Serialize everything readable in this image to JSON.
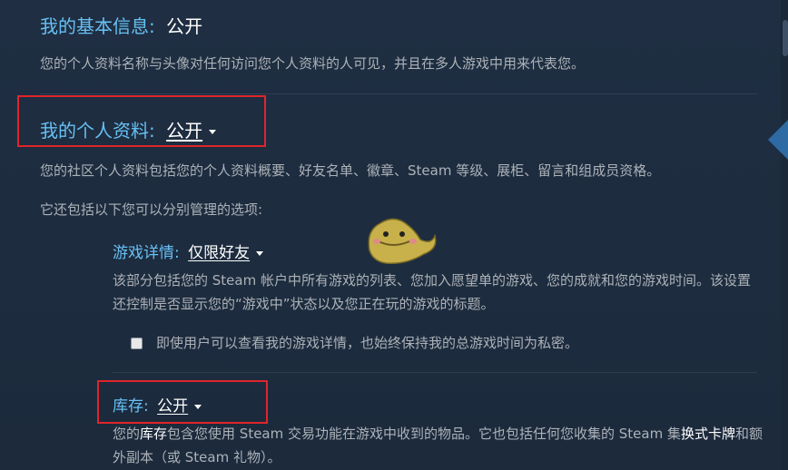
{
  "basic_info": {
    "label": "我的基本信息:",
    "value": "公开",
    "description": "您的个人资料名称与头像对任何访问您个人资料的人可见，并且在多人游戏中用来代表您。"
  },
  "profile": {
    "label": "我的个人资料:",
    "value": "公开",
    "description": "您的社区个人资料包括您的个人资料概要、好友名单、徽章、Steam 等级、展柜、留言和组成员资格。",
    "extra": "它还包括以下您可以分别管理的选项:"
  },
  "game_details": {
    "label": "游戏详情:",
    "value": "仅限好友",
    "description": "该部分包括您的 Steam 帐户中所有游戏的列表、您加入愿望单的游戏、您的成就和您的游戏时间。该设置还控制是否显示您的“游戏中”状态以及您正在玩的游戏的标题。",
    "checkbox_label": "即使用户可以查看我的游戏详情，也始终保持我的总游戏时间为私密。",
    "checkbox_checked": false
  },
  "inventory": {
    "label": "库存:",
    "value": "公开",
    "desc_prefix": "您的",
    "desc_link1": "库存",
    "desc_mid": "包含您使用 Steam 交易功能在游戏中收到的物品。它也包括任何您收集的 Steam 集",
    "desc_link2": "换式卡牌",
    "desc_suffix": "和额外副本（或 Steam 礼物）。"
  },
  "colors": {
    "background": "#1e2c3f",
    "accent_blue": "#67c1f5",
    "body_text": "#acb2b8",
    "highlight_box": "#e0252b"
  }
}
